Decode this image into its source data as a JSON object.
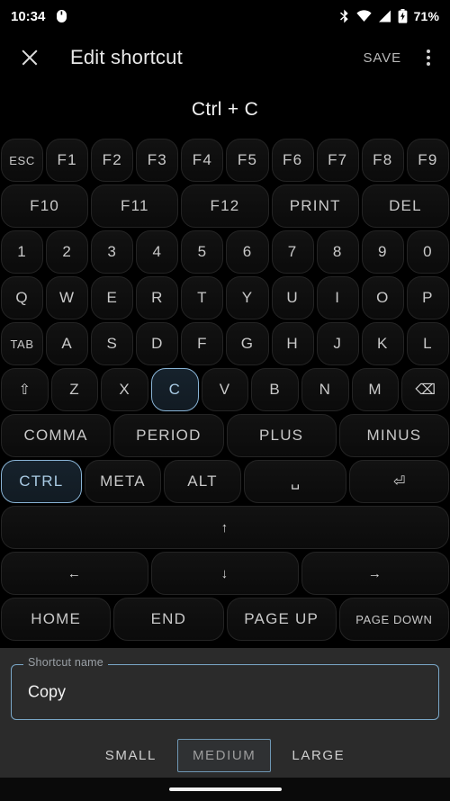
{
  "status_bar": {
    "time": "10:34",
    "battery_percent": "71%",
    "icons": [
      "mouse-icon",
      "bluetooth-icon",
      "wifi-icon",
      "cellular-signal-icon",
      "battery-charging-icon"
    ]
  },
  "app_bar": {
    "close_label": "close-icon",
    "title": "Edit shortcut",
    "save_label": "SAVE",
    "overflow_label": "more-options-icon"
  },
  "combo": {
    "text": "Ctrl + C"
  },
  "keyboard": {
    "rows": [
      {
        "keys": [
          {
            "label": "ESC",
            "selected": false,
            "small": true
          },
          {
            "label": "F1",
            "selected": false
          },
          {
            "label": "F2",
            "selected": false
          },
          {
            "label": "F3",
            "selected": false
          },
          {
            "label": "F4",
            "selected": false
          },
          {
            "label": "F5",
            "selected": false
          },
          {
            "label": "F6",
            "selected": false
          },
          {
            "label": "F7",
            "selected": false
          },
          {
            "label": "F8",
            "selected": false
          },
          {
            "label": "F9",
            "selected": false
          }
        ]
      },
      {
        "keys": [
          {
            "label": "F10",
            "selected": false
          },
          {
            "label": "F11",
            "selected": false
          },
          {
            "label": "F12",
            "selected": false
          },
          {
            "label": "PRINT",
            "selected": false
          },
          {
            "label": "DEL",
            "selected": false
          }
        ]
      },
      {
        "keys": [
          {
            "label": "1",
            "selected": false
          },
          {
            "label": "2",
            "selected": false
          },
          {
            "label": "3",
            "selected": false
          },
          {
            "label": "4",
            "selected": false
          },
          {
            "label": "5",
            "selected": false
          },
          {
            "label": "6",
            "selected": false
          },
          {
            "label": "7",
            "selected": false
          },
          {
            "label": "8",
            "selected": false
          },
          {
            "label": "9",
            "selected": false
          },
          {
            "label": "0",
            "selected": false
          }
        ]
      },
      {
        "keys": [
          {
            "label": "Q",
            "selected": false
          },
          {
            "label": "W",
            "selected": false
          },
          {
            "label": "E",
            "selected": false
          },
          {
            "label": "R",
            "selected": false
          },
          {
            "label": "T",
            "selected": false
          },
          {
            "label": "Y",
            "selected": false
          },
          {
            "label": "U",
            "selected": false
          },
          {
            "label": "I",
            "selected": false
          },
          {
            "label": "O",
            "selected": false
          },
          {
            "label": "P",
            "selected": false
          }
        ]
      },
      {
        "keys": [
          {
            "label": "TAB",
            "selected": false,
            "small": true
          },
          {
            "label": "A",
            "selected": false
          },
          {
            "label": "S",
            "selected": false
          },
          {
            "label": "D",
            "selected": false
          },
          {
            "label": "F",
            "selected": false
          },
          {
            "label": "G",
            "selected": false
          },
          {
            "label": "H",
            "selected": false
          },
          {
            "label": "J",
            "selected": false
          },
          {
            "label": "K",
            "selected": false
          },
          {
            "label": "L",
            "selected": false
          }
        ]
      },
      {
        "keys": [
          {
            "label": "⇧",
            "selected": false,
            "glyph": true
          },
          {
            "label": "Z",
            "selected": false
          },
          {
            "label": "X",
            "selected": false
          },
          {
            "label": "C",
            "selected": true
          },
          {
            "label": "V",
            "selected": false
          },
          {
            "label": "B",
            "selected": false
          },
          {
            "label": "N",
            "selected": false
          },
          {
            "label": "M",
            "selected": false
          },
          {
            "label": "⌫",
            "selected": false,
            "glyph": true
          }
        ]
      },
      {
        "keys": [
          {
            "label": "COMMA",
            "selected": false
          },
          {
            "label": "PERIOD",
            "selected": false
          },
          {
            "label": "PLUS",
            "selected": false
          },
          {
            "label": "MINUS",
            "selected": false
          }
        ]
      },
      {
        "keys": [
          {
            "label": "CTRL",
            "selected": true,
            "flex": 1.05
          },
          {
            "label": "META",
            "selected": false,
            "flex": 1.0
          },
          {
            "label": "ALT",
            "selected": false,
            "flex": 1.0
          },
          {
            "label": "␣",
            "selected": false,
            "glyph": true,
            "flex": 1.35
          },
          {
            "label": "⏎",
            "selected": false,
            "glyph": true,
            "flex": 1.3
          }
        ]
      },
      {
        "keys": [
          {
            "label": "↑",
            "selected": false,
            "arrow": true
          }
        ]
      },
      {
        "keys": [
          {
            "label": "←",
            "selected": false,
            "arrow": true
          },
          {
            "label": "↓",
            "selected": false,
            "arrow": true
          },
          {
            "label": "→",
            "selected": false,
            "arrow": true
          }
        ]
      },
      {
        "keys": [
          {
            "label": "HOME",
            "selected": false
          },
          {
            "label": "END",
            "selected": false
          },
          {
            "label": "PAGE UP",
            "selected": false
          },
          {
            "label": "PAGE DOWN",
            "selected": false,
            "small": true
          }
        ]
      }
    ]
  },
  "panel": {
    "field_label": "Shortcut name",
    "field_value": "Copy",
    "field_placeholder": "Shortcut name",
    "sizes": [
      {
        "label": "SMALL",
        "active": false
      },
      {
        "label": "MEDIUM",
        "active": true
      },
      {
        "label": "LARGE",
        "active": false
      }
    ]
  },
  "colors": {
    "accent": "#7aa7c7",
    "selected_key_border": "#89b4d6",
    "background": "#000000",
    "panel_background": "#2b2b2b"
  }
}
